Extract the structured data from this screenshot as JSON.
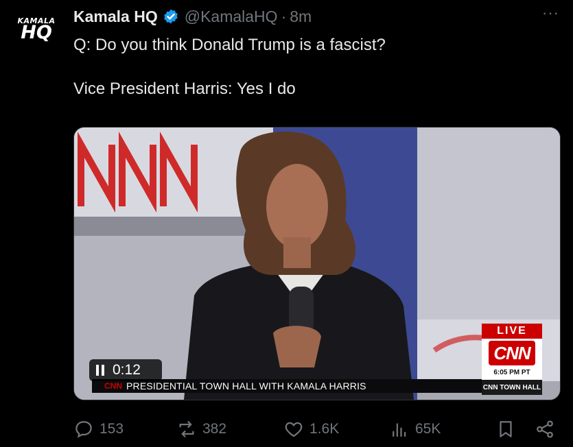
{
  "avatar": {
    "top": "KAMALA",
    "bottom": "HQ"
  },
  "tweet": {
    "name": "Kamala HQ",
    "handle": "@KamalaHQ",
    "separator": "·",
    "time": "8m",
    "more": "···",
    "line1": "Q: Do you think Donald Trump is a fascist?",
    "line2": "Vice President Harris: Yes I do"
  },
  "video": {
    "time": "0:12",
    "lower_third": "PRESIDENTIAL TOWN HALL WITH KAMALA HARRIS",
    "lower_third_logo": "CNN",
    "live": "LIVE",
    "network": "CNN",
    "network_time": "6:05 PM PT",
    "network_show": "CNN TOWN HALL"
  },
  "actions": {
    "replies": "153",
    "reposts": "382",
    "likes": "1.6K",
    "views": "65K"
  },
  "colors": {
    "verified": "#1d9bf0",
    "muted": "#71767b",
    "cnn_red": "#cc0000"
  }
}
